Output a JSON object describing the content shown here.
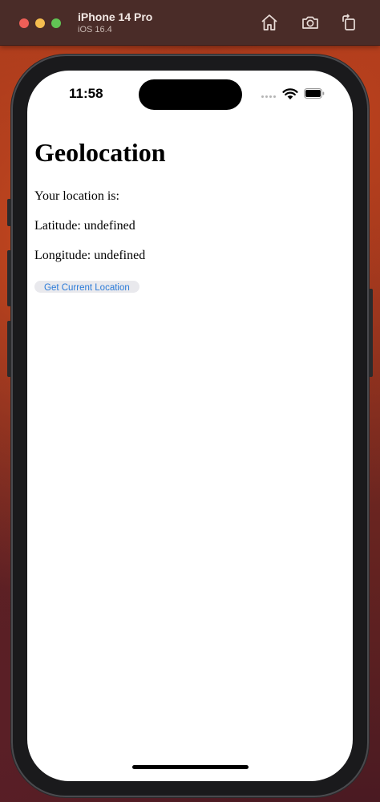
{
  "simulator": {
    "device_name": "iPhone 14 Pro",
    "os_version": "iOS 16.4",
    "toolbar_icons": [
      "home-icon",
      "screenshot-icon",
      "rotate-icon"
    ]
  },
  "status_bar": {
    "time": "11:58",
    "icons": [
      "cellular-signal-icon",
      "wifi-icon",
      "battery-icon"
    ]
  },
  "page": {
    "heading": "Geolocation",
    "intro": "Your location is:",
    "latitude_text": "Latitude: undefined",
    "longitude_text": "Longitude: undefined",
    "button_label": "Get Current Location"
  },
  "colors": {
    "button_text": "#2b7bd8",
    "button_bg": "#e9e9ed",
    "titlebar_bg": "#4a2c28"
  }
}
